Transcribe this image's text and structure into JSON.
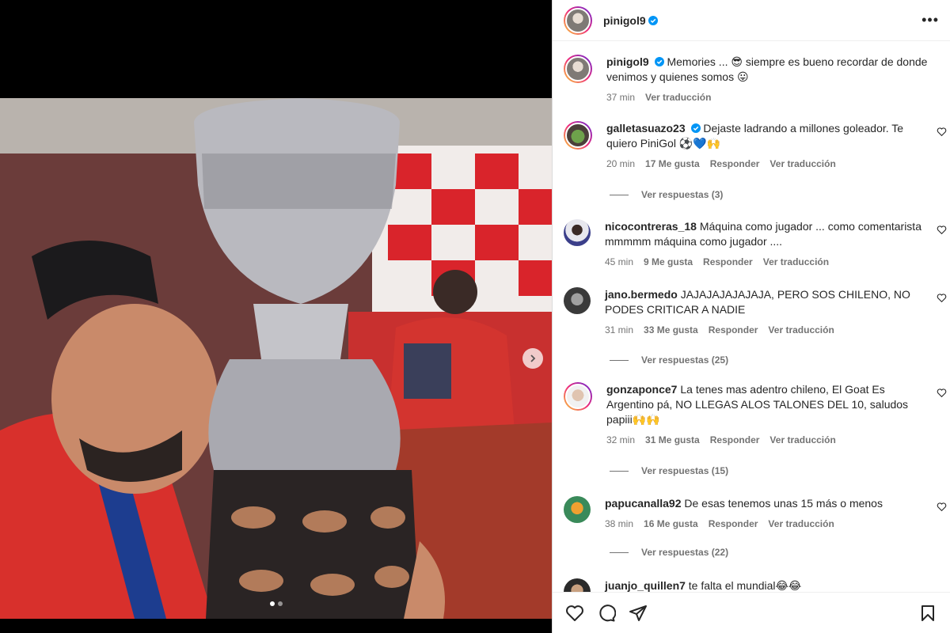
{
  "post": {
    "username": "pinigol9",
    "caption": "Memories ... 😎 siempre es bueno recordar de donde venimos y quienes somos 😛",
    "time": "37 min",
    "translate": "Ver traducción"
  },
  "comments": [
    {
      "user": "galletasuazo23",
      "verified": true,
      "text": "Dejaste ladrando a millones goleador. Te quiero PiniGol ⚽💙🙌",
      "time": "20 min",
      "likes": "17 Me gusta",
      "reply": "Responder",
      "translate": "Ver traducción",
      "replies": "Ver respuestas (3)"
    },
    {
      "user": "nicocontreras_18",
      "verified": false,
      "text": "Máquina como jugador ... como comentarista mmmmm máquina como jugador ....",
      "time": "45 min",
      "likes": "9 Me gusta",
      "reply": "Responder",
      "translate": "Ver traducción",
      "replies": ""
    },
    {
      "user": "jano.bermedo",
      "verified": false,
      "text": "JAJAJAJAJAJAJA, PERO SOS CHILENO, NO PODES CRITICAR A NADIE",
      "time": "31 min",
      "likes": "33 Me gusta",
      "reply": "Responder",
      "translate": "Ver traducción",
      "replies": "Ver respuestas (25)"
    },
    {
      "user": "gonzaponce7",
      "verified": false,
      "text": "La tenes mas adentro chileno, El Goat Es Argentino pá, NO LLEGAS ALOS TALONES DEL 10, saludos papiii🙌🙌",
      "time": "32 min",
      "likes": "31 Me gusta",
      "reply": "Responder",
      "translate": "Ver traducción",
      "replies": "Ver respuestas (15)"
    },
    {
      "user": "papucanalla92",
      "verified": false,
      "text": "De esas tenemos unas 15 más o menos",
      "time": "38 min",
      "likes": "16 Me gusta",
      "reply": "Responder",
      "translate": "Ver traducción",
      "replies": "Ver respuestas (22)"
    },
    {
      "user": "juanjo_quillen7",
      "verified": false,
      "text": "te falta el mundial😂😂",
      "time": "",
      "likes": "",
      "reply": "",
      "translate": "",
      "replies": ""
    }
  ],
  "icons": {
    "like": "heart-icon",
    "comment": "comment-icon",
    "share": "share-icon",
    "save": "bookmark-icon",
    "more": "more-options-icon",
    "next": "chevron-right-icon"
  },
  "colors": {
    "verified": "#0095f6",
    "meta_text": "#737373",
    "text": "#262626"
  },
  "carousel": {
    "slides": 2,
    "current": 1
  }
}
